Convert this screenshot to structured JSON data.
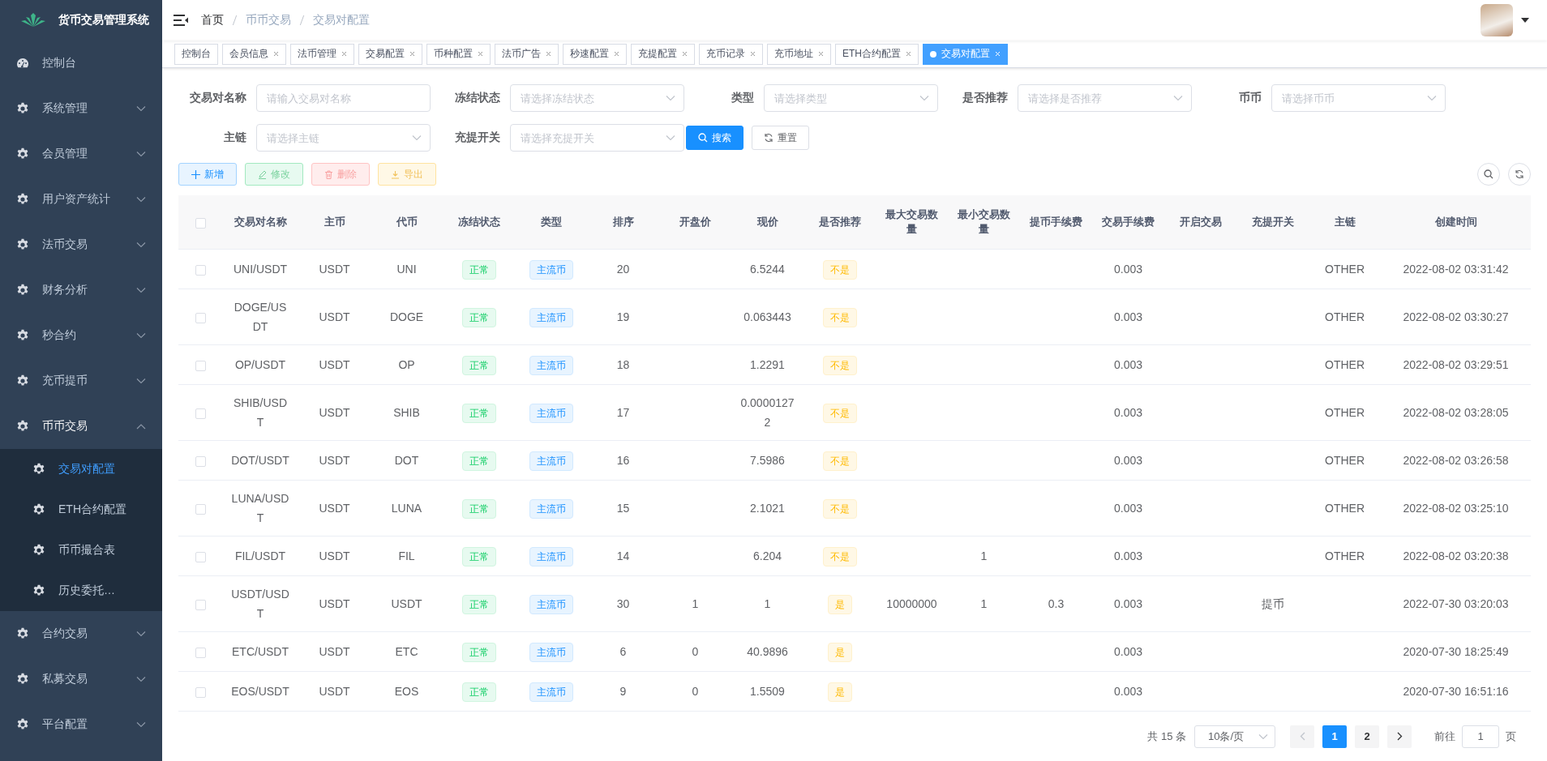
{
  "app": {
    "title": "货币交易管理系统"
  },
  "sidebar": {
    "items": [
      {
        "label": "控制台",
        "kind": "link"
      },
      {
        "label": "系统管理",
        "kind": "menu",
        "expanded": false
      },
      {
        "label": "会员管理",
        "kind": "menu",
        "expanded": false
      },
      {
        "label": "用户资产统计",
        "kind": "menu",
        "expanded": false
      },
      {
        "label": "法币交易",
        "kind": "menu",
        "expanded": false
      },
      {
        "label": "财务分析",
        "kind": "menu",
        "expanded": false
      },
      {
        "label": "秒合约",
        "kind": "menu",
        "expanded": false
      },
      {
        "label": "充币提币",
        "kind": "menu",
        "expanded": false
      },
      {
        "label": "币币交易",
        "kind": "menu",
        "expanded": true,
        "children": [
          {
            "label": "交易对配置",
            "selected": true
          },
          {
            "label": "ETH合约配置",
            "selected": false
          },
          {
            "label": "币币撮合表",
            "selected": false
          },
          {
            "label": "历史委托…",
            "selected": false
          }
        ]
      },
      {
        "label": "合约交易",
        "kind": "menu",
        "expanded": false
      },
      {
        "label": "私募交易",
        "kind": "menu",
        "expanded": false
      },
      {
        "label": "平台配置",
        "kind": "menu",
        "expanded": false
      }
    ]
  },
  "breadcrumb": [
    "首页",
    "币币交易",
    "交易对配置"
  ],
  "tabs": [
    {
      "label": "控制台",
      "selected": false,
      "closable": false
    },
    {
      "label": "会员信息",
      "selected": false,
      "closable": true
    },
    {
      "label": "法币管理",
      "selected": false,
      "closable": true
    },
    {
      "label": "交易配置",
      "selected": false,
      "closable": true
    },
    {
      "label": "币种配置",
      "selected": false,
      "closable": true
    },
    {
      "label": "法币广告",
      "selected": false,
      "closable": true
    },
    {
      "label": "秒速配置",
      "selected": false,
      "closable": true
    },
    {
      "label": "充提配置",
      "selected": false,
      "closable": true
    },
    {
      "label": "充币记录",
      "selected": false,
      "closable": true
    },
    {
      "label": "充币地址",
      "selected": false,
      "closable": true
    },
    {
      "label": "ETH合约配置",
      "selected": false,
      "closable": true
    },
    {
      "label": "交易对配置",
      "selected": true,
      "closable": true
    }
  ],
  "filters": [
    {
      "label": "交易对名称",
      "kind": "input",
      "placeholder": "请输入交易对名称"
    },
    {
      "label": "冻结状态",
      "kind": "select",
      "placeholder": "请选择冻结状态"
    },
    {
      "label": "类型",
      "kind": "select",
      "placeholder": "请选择类型"
    },
    {
      "label": "是否推荐",
      "kind": "select",
      "placeholder": "请选择是否推荐"
    },
    {
      "label": "币币",
      "kind": "select",
      "placeholder": "请选择币币"
    },
    {
      "label": "主链",
      "kind": "select",
      "placeholder": "请选择主链"
    },
    {
      "label": "充提开关",
      "kind": "select",
      "placeholder": "请选择充提开关"
    }
  ],
  "search_buttons": [
    {
      "label": "搜索",
      "kind": "search"
    },
    {
      "label": "重置",
      "kind": "reset"
    }
  ],
  "toolbar": [
    {
      "label": "新增",
      "kind": "add"
    },
    {
      "label": "修改",
      "kind": "edit"
    },
    {
      "label": "删除",
      "kind": "delete"
    },
    {
      "label": "导出",
      "kind": "export"
    }
  ],
  "table": {
    "select_all": {
      "checked": false
    },
    "columns": [
      "交易对名称",
      "主币",
      "代币",
      "冻结状态",
      "类型",
      "排序",
      "开盘价",
      "现价",
      "是否推荐",
      "最大交易数量",
      "最小交易数量",
      "提币手续费",
      "交易手续费",
      "开启交易",
      "充提开关",
      "主链",
      "创建时间"
    ],
    "rows": [
      {
        "checked": false,
        "name": "UNI/USDT",
        "base": "USDT",
        "coin": "UNI",
        "status": "正常",
        "type": "主流币",
        "sort": "20",
        "price": "6.5244",
        "recommended": "不是",
        "trade_fee": "0.003",
        "chain": "OTHER",
        "created": "2022-08-02 03:31:42"
      },
      {
        "checked": false,
        "name": "DOGE/USDT",
        "base": "USDT",
        "coin": "DOGE",
        "status": "正常",
        "type": "主流币",
        "sort": "19",
        "price": "0.063443",
        "recommended": "不是",
        "trade_fee": "0.003",
        "chain": "OTHER",
        "created": "2022-08-02 03:30:27"
      },
      {
        "checked": false,
        "name": "OP/USDT",
        "base": "USDT",
        "coin": "OP",
        "status": "正常",
        "type": "主流币",
        "sort": "18",
        "price": "1.2291",
        "recommended": "不是",
        "trade_fee": "0.003",
        "chain": "OTHER",
        "created": "2022-08-02 03:29:51"
      },
      {
        "checked": false,
        "name": "SHIB/USDT",
        "base": "USDT",
        "coin": "SHIB",
        "status": "正常",
        "type": "主流币",
        "sort": "17",
        "price": "0.00001272",
        "recommended": "不是",
        "trade_fee": "0.003",
        "chain": "OTHER",
        "created": "2022-08-02 03:28:05"
      },
      {
        "checked": false,
        "name": "DOT/USDT",
        "base": "USDT",
        "coin": "DOT",
        "status": "正常",
        "type": "主流币",
        "sort": "16",
        "price": "7.5986",
        "recommended": "不是",
        "trade_fee": "0.003",
        "chain": "OTHER",
        "created": "2022-08-02 03:26:58"
      },
      {
        "checked": false,
        "name": "LUNA/USDT",
        "base": "USDT",
        "coin": "LUNA",
        "status": "正常",
        "type": "主流币",
        "sort": "15",
        "price": "2.1021",
        "recommended": "不是",
        "trade_fee": "0.003",
        "chain": "OTHER",
        "created": "2022-08-02 03:25:10"
      },
      {
        "checked": false,
        "name": "FIL/USDT",
        "base": "USDT",
        "coin": "FIL",
        "status": "正常",
        "type": "主流币",
        "sort": "14",
        "price": "6.204",
        "recommended": "不是",
        "min_qty": "1",
        "trade_fee": "0.003",
        "chain": "OTHER",
        "created": "2022-08-02 03:20:38"
      },
      {
        "checked": false,
        "name": "USDT/USDT",
        "base": "USDT",
        "coin": "USDT",
        "status": "正常",
        "type": "主流币",
        "sort": "30",
        "open": "1",
        "price": "1",
        "recommended": "是",
        "max_qty": "10000000",
        "min_qty": "1",
        "withdraw_fee": "0.3",
        "trade_fee": "0.003",
        "deposit_switch": "提币",
        "created": "2022-07-30 03:20:03"
      },
      {
        "checked": false,
        "name": "ETC/USDT",
        "base": "USDT",
        "coin": "ETC",
        "status": "正常",
        "type": "主流币",
        "sort": "6",
        "open": "0",
        "price": "40.9896",
        "recommended": "是",
        "trade_fee": "0.003",
        "created": "2020-07-30 18:25:49"
      },
      {
        "checked": false,
        "name": "EOS/USDT",
        "base": "USDT",
        "coin": "EOS",
        "status": "正常",
        "type": "主流币",
        "sort": "9",
        "open": "0",
        "price": "1.5509",
        "recommended": "是",
        "trade_fee": "0.003",
        "created": "2020-07-30 16:51:16"
      }
    ]
  },
  "pagination": {
    "total": "共 15 条",
    "page_size": "10条/页",
    "prev_disabled": true,
    "pages": [
      {
        "label": "1",
        "selected": true
      },
      {
        "label": "2",
        "selected": false
      }
    ],
    "goto_label": "前往",
    "goto_value": "1",
    "goto_suffix": "页"
  }
}
